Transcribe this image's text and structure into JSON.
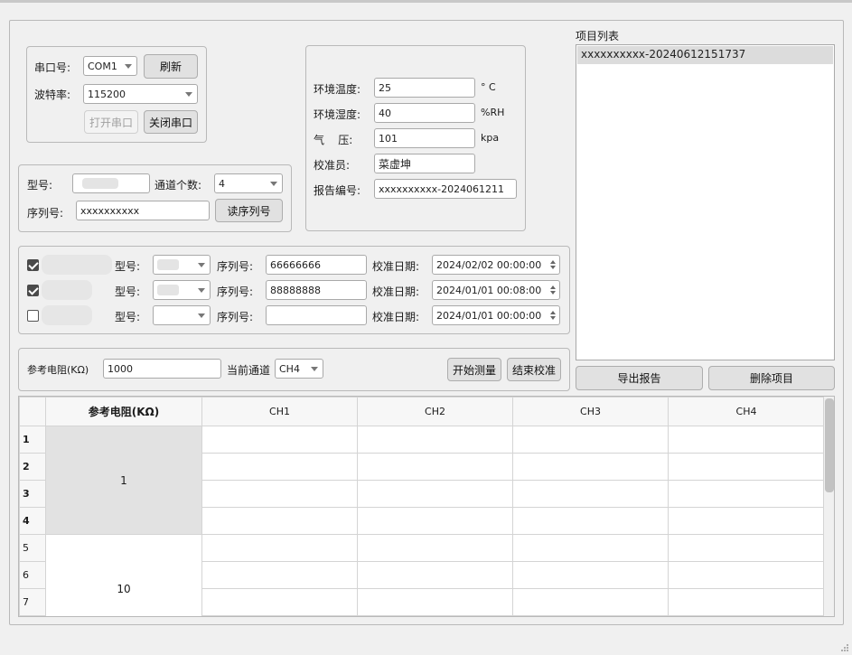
{
  "serial": {
    "port_label": "串口号:",
    "port_value": "COM1",
    "refresh_label": "刷新",
    "baud_label": "波特率:",
    "baud_value": "115200",
    "open_label": "打开串口",
    "close_label": "关闭串口"
  },
  "environment": {
    "temp_label": "环境温度:",
    "temp_value": "25",
    "temp_unit": "° C",
    "humidity_label": "环境湿度:",
    "humidity_value": "40",
    "humidity_unit": "%RH",
    "pressure_label": "气    压:",
    "pressure_value": "101",
    "pressure_unit": "kpa",
    "calibrator_label": "校准员:",
    "calibrator_value": "菜虚坤",
    "report_label": "报告编号:",
    "report_value": "xxxxxxxxxx-2024061211"
  },
  "device": {
    "model_label": "型号:",
    "channels_label": "通道个数:",
    "channels_value": "4",
    "serial_label": "序列号:",
    "serial_value": "xxxxxxxxxx",
    "read_serial_label": "读序列号"
  },
  "instruments": {
    "model_label": "型号:",
    "serial_label": "序列号:",
    "date_label": "校准日期:",
    "rows": [
      {
        "checked": true,
        "serial": "66666666",
        "date": "2024/02/02 00:00:00"
      },
      {
        "checked": true,
        "serial": "88888888",
        "date": "2024/01/01 00:08:00"
      },
      {
        "checked": false,
        "serial": "",
        "date": "2024/01/01 00:00:00"
      }
    ]
  },
  "measure": {
    "ref_label": "参考电阻(KΩ)",
    "ref_value": "1000",
    "channel_label": "当前通道",
    "channel_value": "CH4",
    "start_label": "开始测量",
    "end_label": "结束校准"
  },
  "projects": {
    "title": "项目列表",
    "items": [
      "xxxxxxxxxx-20240612151737"
    ],
    "export_label": "导出报告",
    "delete_label": "删除项目"
  },
  "table": {
    "headers": [
      "参考电阻(KΩ)",
      "CH1",
      "CH2",
      "CH3",
      "CH4"
    ],
    "row_numbers": [
      "1",
      "2",
      "3",
      "4",
      "5",
      "6",
      "7"
    ],
    "groups": [
      "1",
      "10"
    ]
  }
}
